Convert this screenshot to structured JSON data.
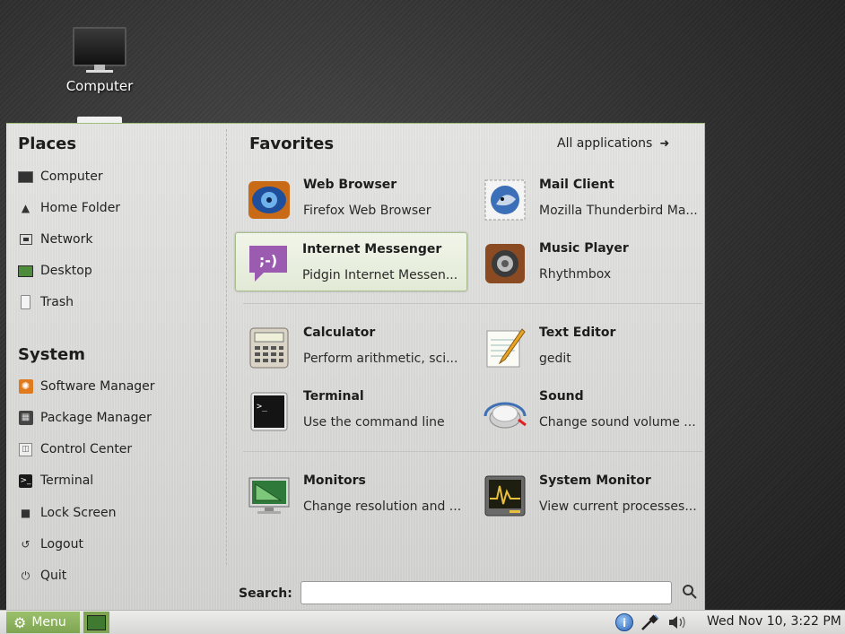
{
  "desktop": {
    "icons": [
      {
        "label": "Computer",
        "icon": "computer-icon"
      }
    ]
  },
  "menu": {
    "places": {
      "title": "Places",
      "items": [
        {
          "label": "Computer",
          "icon": "computer-icon"
        },
        {
          "label": "Home Folder",
          "icon": "home-icon"
        },
        {
          "label": "Network",
          "icon": "network-icon"
        },
        {
          "label": "Desktop",
          "icon": "desktop-icon"
        },
        {
          "label": "Trash",
          "icon": "trash-icon"
        }
      ]
    },
    "system": {
      "title": "System",
      "items": [
        {
          "label": "Software Manager",
          "icon": "software-manager-icon"
        },
        {
          "label": "Package Manager",
          "icon": "package-manager-icon"
        },
        {
          "label": "Control Center",
          "icon": "control-center-icon"
        },
        {
          "label": "Terminal",
          "icon": "terminal-icon"
        },
        {
          "label": "Lock Screen",
          "icon": "lock-icon"
        },
        {
          "label": "Logout",
          "icon": "logout-icon"
        },
        {
          "label": "Quit",
          "icon": "power-icon"
        }
      ]
    },
    "favorites": {
      "title": "Favorites",
      "all_applications": "All applications",
      "apps": [
        {
          "name": "Web Browser",
          "desc": "Firefox Web Browser",
          "icon": "firefox-icon"
        },
        {
          "name": "Mail Client",
          "desc": "Mozilla Thunderbird Ma...",
          "icon": "thunderbird-icon"
        },
        {
          "name": "Internet Messenger",
          "desc": "Pidgin Internet Messen...",
          "icon": "pidgin-icon",
          "highlighted": true
        },
        {
          "name": "Music Player",
          "desc": "Rhythmbox",
          "icon": "speaker-icon"
        },
        {
          "name": "Calculator",
          "desc": "Perform arithmetic, sci...",
          "icon": "calculator-icon"
        },
        {
          "name": "Text Editor",
          "desc": "gedit",
          "icon": "text-editor-icon"
        },
        {
          "name": "Terminal",
          "desc": "Use the command line",
          "icon": "terminal-icon"
        },
        {
          "name": "Sound",
          "desc": "Change sound volume ...",
          "icon": "sound-knob-icon"
        },
        {
          "name": "Monitors",
          "desc": "Change resolution and ...",
          "icon": "monitor-icon"
        },
        {
          "name": "System Monitor",
          "desc": "View current processes...",
          "icon": "system-monitor-icon"
        }
      ]
    },
    "search": {
      "label": "Search:",
      "value": "",
      "placeholder": ""
    }
  },
  "panel": {
    "menu_label": "Menu",
    "clock": "Wed Nov 10,  3:22 PM",
    "tray": [
      "update-shield-icon",
      "network-plug-icon",
      "volume-icon"
    ]
  },
  "colors": {
    "accent_green": "#8db55e",
    "panel_bg": "#dcdcda"
  }
}
